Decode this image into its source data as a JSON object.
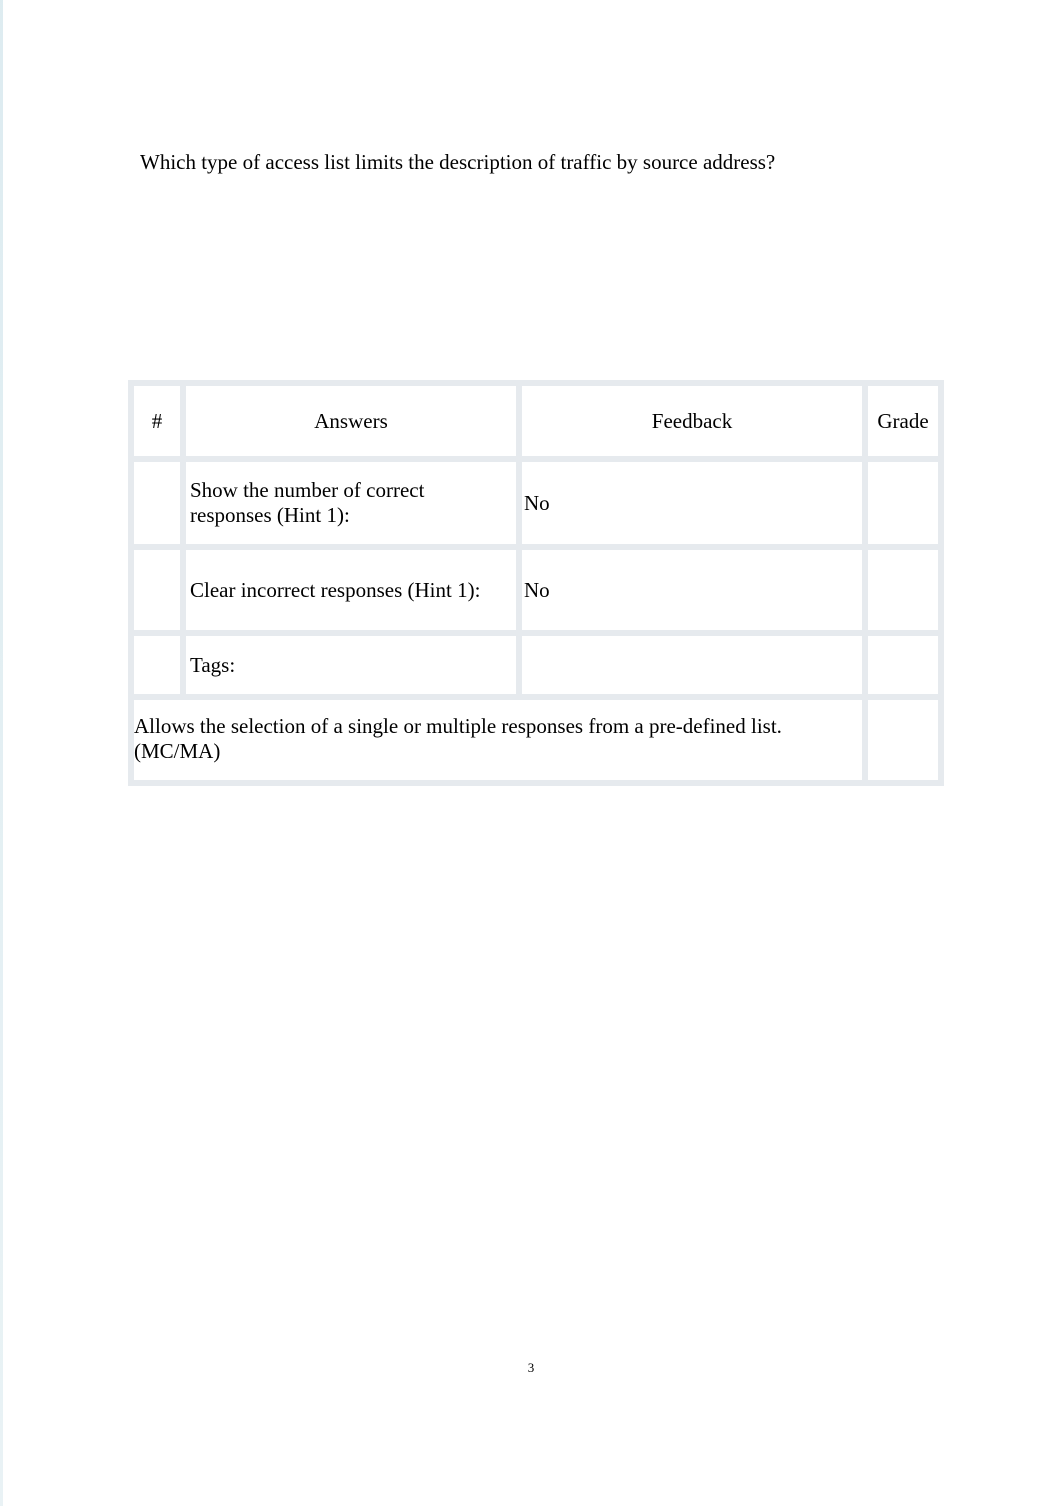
{
  "question": "Which type of access list limits the description of traffic by source address?",
  "table": {
    "headers": {
      "num": "#",
      "answers": "Answers",
      "feedback": "Feedback",
      "grade": "Grade"
    },
    "rows": [
      {
        "num": "",
        "answers": "Show the number of correct responses (Hint 1):",
        "feedback": "No",
        "grade": ""
      },
      {
        "num": "",
        "answers": "Clear incorrect responses (Hint 1):",
        "feedback": "No",
        "grade": ""
      },
      {
        "num": "",
        "answers": "Tags:",
        "feedback": "",
        "grade": ""
      }
    ],
    "footer": "Allows the selection of a single or multiple responses from a pre-defined list. (MC/MA)"
  },
  "page_number": "3"
}
